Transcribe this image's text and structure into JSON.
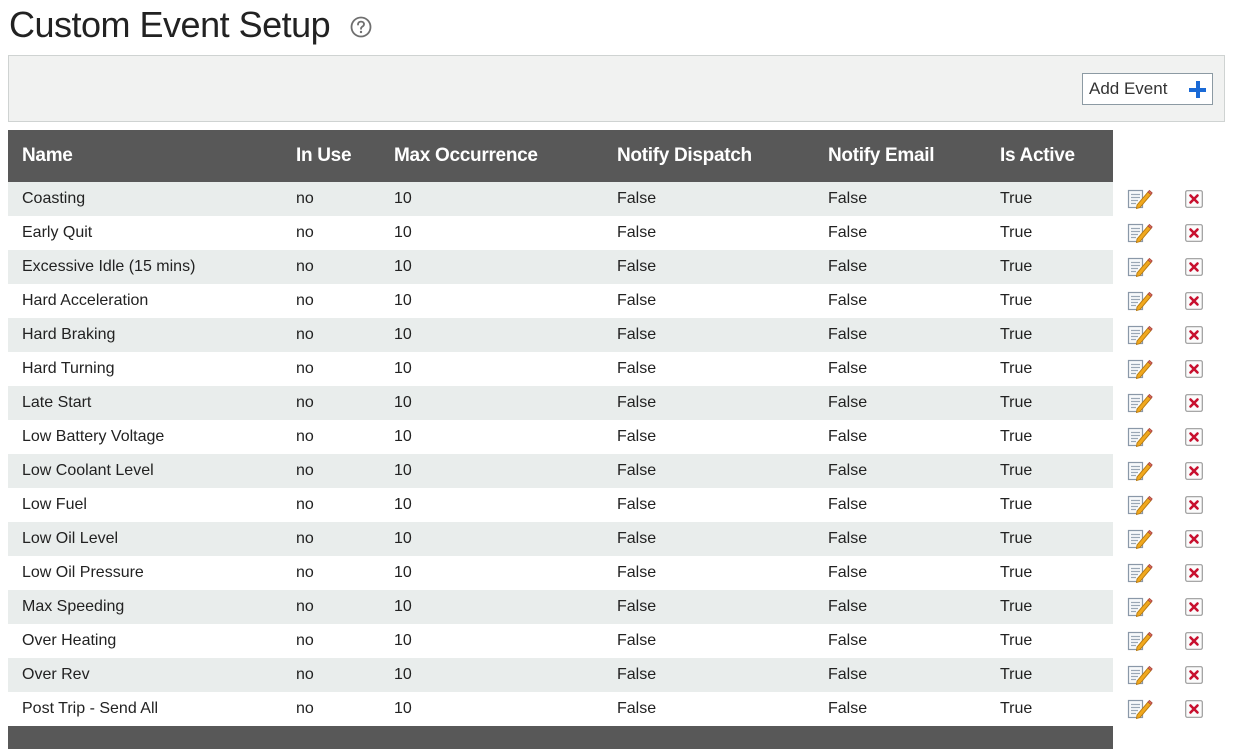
{
  "page": {
    "title": "Custom Event Setup"
  },
  "toolbar": {
    "add_event_label": "Add Event"
  },
  "table": {
    "columns": [
      "Name",
      "In Use",
      "Max Occurrence",
      "Notify Dispatch",
      "Notify Email",
      "Is Active"
    ],
    "rows": [
      {
        "name": "Coasting",
        "in_use": "no",
        "max": "10",
        "dispatch": "False",
        "email": "False",
        "active": "True"
      },
      {
        "name": "Early Quit",
        "in_use": "no",
        "max": "10",
        "dispatch": "False",
        "email": "False",
        "active": "True"
      },
      {
        "name": "Excessive Idle (15 mins)",
        "in_use": "no",
        "max": "10",
        "dispatch": "False",
        "email": "False",
        "active": "True"
      },
      {
        "name": "Hard Acceleration",
        "in_use": "no",
        "max": "10",
        "dispatch": "False",
        "email": "False",
        "active": "True"
      },
      {
        "name": "Hard Braking",
        "in_use": "no",
        "max": "10",
        "dispatch": "False",
        "email": "False",
        "active": "True"
      },
      {
        "name": "Hard Turning",
        "in_use": "no",
        "max": "10",
        "dispatch": "False",
        "email": "False",
        "active": "True"
      },
      {
        "name": "Late Start",
        "in_use": "no",
        "max": "10",
        "dispatch": "False",
        "email": "False",
        "active": "True"
      },
      {
        "name": "Low Battery Voltage",
        "in_use": "no",
        "max": "10",
        "dispatch": "False",
        "email": "False",
        "active": "True"
      },
      {
        "name": "Low Coolant Level",
        "in_use": "no",
        "max": "10",
        "dispatch": "False",
        "email": "False",
        "active": "True"
      },
      {
        "name": "Low Fuel",
        "in_use": "no",
        "max": "10",
        "dispatch": "False",
        "email": "False",
        "active": "True"
      },
      {
        "name": "Low Oil Level",
        "in_use": "no",
        "max": "10",
        "dispatch": "False",
        "email": "False",
        "active": "True"
      },
      {
        "name": "Low Oil Pressure",
        "in_use": "no",
        "max": "10",
        "dispatch": "False",
        "email": "False",
        "active": "True"
      },
      {
        "name": "Max Speeding",
        "in_use": "no",
        "max": "10",
        "dispatch": "False",
        "email": "False",
        "active": "True"
      },
      {
        "name": "Over Heating",
        "in_use": "no",
        "max": "10",
        "dispatch": "False",
        "email": "False",
        "active": "True"
      },
      {
        "name": "Over Rev",
        "in_use": "no",
        "max": "10",
        "dispatch": "False",
        "email": "False",
        "active": "True"
      },
      {
        "name": "Post Trip - Send All",
        "in_use": "no",
        "max": "10",
        "dispatch": "False",
        "email": "False",
        "active": "True"
      }
    ]
  },
  "icons": {
    "help": "help-circle-icon",
    "add": "plus-icon",
    "edit": "edit-icon",
    "delete": "delete-icon"
  },
  "colors": {
    "header_bg": "#585858",
    "row_stripe": "#e9edec",
    "toolbar_bg": "#f1f2f1",
    "add_icon": "#1a6ad6",
    "delete_icon": "#c8102e",
    "edit_pencil": "#f0a81e"
  }
}
